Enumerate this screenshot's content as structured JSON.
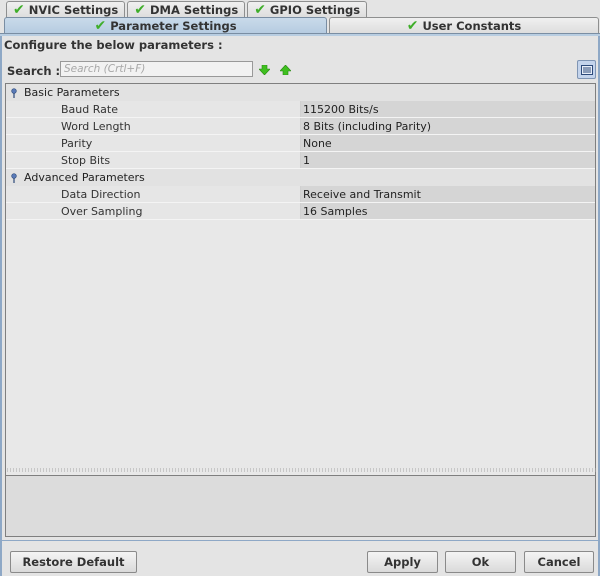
{
  "tabs": {
    "row_back": [
      {
        "label": "NVIC Settings",
        "icon": "check-icon"
      },
      {
        "label": "DMA Settings",
        "icon": "check-icon"
      },
      {
        "label": "GPIO Settings",
        "icon": "check-icon"
      }
    ],
    "row_front": [
      {
        "label": "Parameter Settings",
        "icon": "check-icon",
        "active": true
      },
      {
        "label": "User Constants",
        "icon": "check-icon",
        "active": false
      }
    ]
  },
  "header": {
    "configure_label": "Configure the below parameters :",
    "search_label": "Search :",
    "search_placeholder": "Search (Crtl+F)",
    "search_value": ""
  },
  "groups": [
    {
      "label": "Basic Parameters",
      "icon": "pin-icon",
      "properties": [
        {
          "name": "Baud Rate",
          "value": "115200 Bits/s"
        },
        {
          "name": "Word Length",
          "value": "8 Bits (including Parity)"
        },
        {
          "name": "Parity",
          "value": "None"
        },
        {
          "name": "Stop Bits",
          "value": "1"
        }
      ]
    },
    {
      "label": "Advanced Parameters",
      "icon": "pin-icon",
      "properties": [
        {
          "name": "Data Direction",
          "value": "Receive and Transmit"
        },
        {
          "name": "Over Sampling",
          "value": "16 Samples"
        }
      ]
    }
  ],
  "buttons": {
    "restore_default": "Restore Default",
    "apply": "Apply",
    "ok": "Ok",
    "cancel": "Cancel"
  },
  "colors": {
    "active_tab": "#b5cbe0",
    "check_green": "#3fae2a",
    "arrow_green": "#3fbf1f"
  }
}
